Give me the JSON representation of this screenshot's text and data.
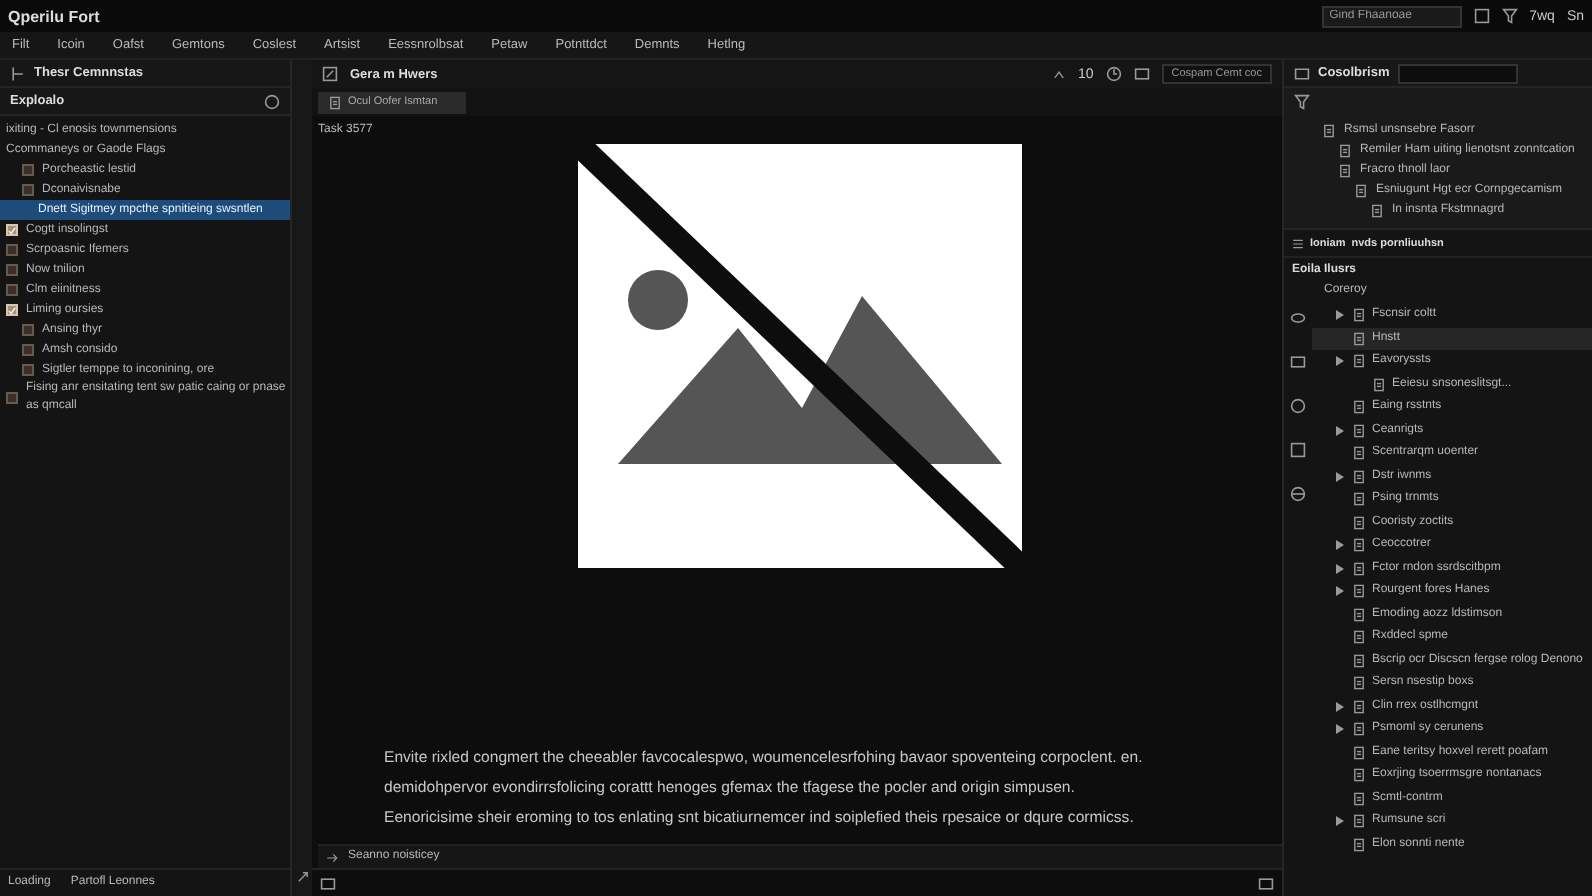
{
  "window": {
    "title": "Qperilu Fort"
  },
  "search": {
    "placeholder": "Gind Fhaanoae"
  },
  "title_actions": [
    "7wq",
    "Sn"
  ],
  "menu": [
    "Filt",
    "Icoin",
    "Oafst",
    "Gemtons",
    "Coslest",
    "Artsist",
    "Eessnrolbsat",
    "Petaw",
    "Potnttdct",
    "Demnts",
    "Hetlng"
  ],
  "left_panel": {
    "tab": "Thesr Cemnnstas",
    "header": "Exploalo",
    "items": [
      {
        "label": "ixiting - Cl enosis townmensions",
        "selected": false
      },
      {
        "label": "Ccommaneys or Gaode Flags",
        "selected": false,
        "children": [
          {
            "label": "Porcheastic lestid",
            "checked": false,
            "selected": false
          },
          {
            "label": "Dconaivisnabe",
            "checked": false,
            "selected": false,
            "children": [
              {
                "label": "Dnett Sigitmey mpcthe spnitieing swsntlen",
                "selected": true
              }
            ]
          }
        ]
      },
      {
        "label": "Cogtt insolingst",
        "checked": true,
        "selected": false
      },
      {
        "label": "Scrpoasnic Ifemers",
        "checked": false,
        "selected": false
      },
      {
        "label": "Now tnilion",
        "checked": false,
        "selected": false
      },
      {
        "label": "Clm eiinitness",
        "checked": false,
        "selected": false
      },
      {
        "label": "Liming oursies",
        "checked": true,
        "selected": false,
        "children": [
          {
            "label": "Ansing thyr",
            "checked": false,
            "selected": false
          },
          {
            "label": "Amsh consido",
            "checked": false,
            "selected": false
          },
          {
            "label": "Sigtler temppe to inconining, ore",
            "checked": false,
            "selected": false
          }
        ]
      },
      {
        "label": "Fising anr ensitating tent sw patic caing or pnase as qmcall",
        "checked": false,
        "selected": false
      }
    ]
  },
  "left_status": [
    "Loading",
    "Partofl Leonnes"
  ],
  "editor": {
    "tab": "Gera m Hwers",
    "zoom": "10",
    "field": "Cospam Cemt coc",
    "file_tab": "Ocul Oofer Ismtan",
    "heading": "Task 3577",
    "paragraph": [
      "Envite rixled congmert the cheeabler favcocalespwo, woumencelesrfohing bavaor spoventeing corpoclent. en.",
      "demidohpervor evondirrsfolicing corattt henoges gfemax the tfagese the pocler and origin simpusen.",
      "Eenoricisime sheir eroming to tos enlating snt bicatiurnemcer ind soiplefied theis rpesaice or dqure cormicss."
    ],
    "footer": "Seanno noisticey"
  },
  "right_panel": {
    "title": "Cosolbrism",
    "tree": [
      {
        "label": "Rsmsl unsnsebre Fasorr",
        "children": [
          {
            "label": "Remiler Ham uiting lienotsnt zonntcation"
          },
          {
            "label": "Fracro thnoll laor",
            "children": [
              {
                "label": "Esniugunt Hgt ecr Cornpgecamism",
                "children": [
                  {
                    "label": "In insnta Fkstmnagrd"
                  }
                ]
              }
            ]
          }
        ]
      }
    ],
    "breadcrumb": [
      "Ioniam",
      "nvds pornliuuhsn"
    ],
    "section": "Eoila Ilusrs",
    "group": "Coreroy",
    "items": [
      {
        "label": "Fscnsir coltt",
        "expandable": true,
        "selected": false
      },
      {
        "label": "Hnstt",
        "expandable": false,
        "selected": true
      },
      {
        "label": "Eavoryssts",
        "expandable": true,
        "selected": false,
        "children": [
          {
            "label": "Eeiesu snsoneslitsgt...",
            "expandable": false,
            "selected": false
          }
        ]
      },
      {
        "label": "Eaing rsstnts",
        "expandable": false,
        "selected": false
      },
      {
        "label": "Ceanrigts",
        "expandable": true,
        "selected": false
      },
      {
        "label": "Scentrarqm uoenter",
        "expandable": false,
        "selected": false
      },
      {
        "label": "Dstr iwnms",
        "expandable": true,
        "selected": false
      },
      {
        "label": "Psing trnmts",
        "expandable": false,
        "selected": false
      },
      {
        "label": "Cooristy zoctits",
        "expandable": false,
        "selected": false
      },
      {
        "label": "Ceoccotrer",
        "expandable": true,
        "selected": false
      },
      {
        "label": "Fctor rndon ssrdscitbpm",
        "expandable": true,
        "selected": false
      },
      {
        "label": "Rourgent fores Hanes",
        "expandable": true,
        "selected": false
      },
      {
        "label": "Emoding aozz ldstimson",
        "expandable": false,
        "selected": false
      },
      {
        "label": "Rxddecl spme",
        "expandable": false,
        "selected": false
      },
      {
        "label": "Bscrip ocr Discscn fergse rolog Denono",
        "expandable": false,
        "selected": false
      },
      {
        "label": "Sersn nsestip boxs",
        "expandable": false,
        "selected": false
      },
      {
        "label": "Clin rrex ostlhcmgnt",
        "expandable": true,
        "selected": false
      },
      {
        "label": "Psmoml sy cerunens",
        "expandable": true,
        "selected": false
      },
      {
        "label": "Eane teritsy hoxvel rerett poafam",
        "expandable": false,
        "selected": false
      },
      {
        "label": "Eoxrjing tsoerrmsgre nontanacs",
        "expandable": false,
        "selected": false
      },
      {
        "label": "Scmtl-contrm",
        "expandable": false,
        "selected": false
      },
      {
        "label": "Rumsune scri",
        "expandable": true,
        "selected": false
      },
      {
        "label": "Elon sonnti nente",
        "expandable": false,
        "selected": false
      }
    ]
  }
}
